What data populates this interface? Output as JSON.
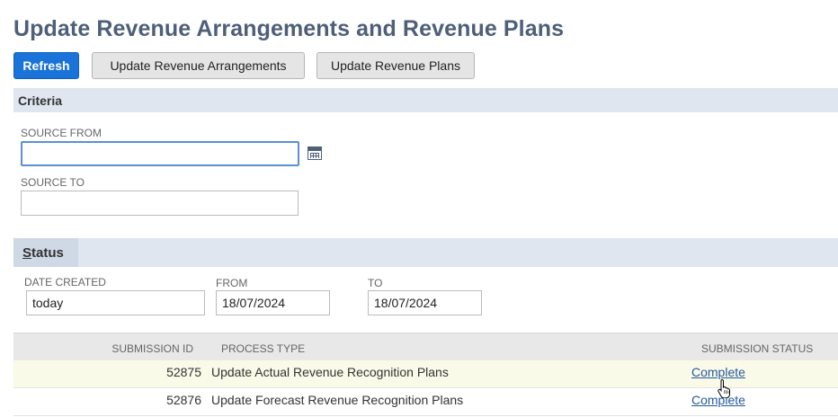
{
  "page": {
    "title": "Update Revenue Arrangements and Revenue Plans"
  },
  "toolbar": {
    "refresh_label": "Refresh",
    "update_arrangements_label": "Update Revenue Arrangements",
    "update_plans_label": "Update Revenue Plans"
  },
  "criteria": {
    "heading": "Criteria",
    "source_from_label": "SOURCE FROM",
    "source_from_value": "",
    "source_to_label": "SOURCE TO",
    "source_to_value": ""
  },
  "status": {
    "tab_label": "Status",
    "date_created_label": "DATE CREATED",
    "date_created_value": "today",
    "from_label": "FROM",
    "from_value": "18/07/2024",
    "to_label": "TO",
    "to_value": "18/07/2024"
  },
  "table": {
    "columns": [
      "SUBMISSION ID",
      "PROCESS TYPE",
      "SUBMISSION STATUS"
    ],
    "rows": [
      {
        "id": "52875",
        "type": "Update Actual Revenue Recognition Plans",
        "status": "Complete"
      },
      {
        "id": "52876",
        "type": "Update Forecast Revenue Recognition Plans",
        "status": "Complete"
      }
    ]
  },
  "icons": {
    "calendar": "calendar-icon",
    "cursor": "hand-pointer-cursor"
  },
  "colors": {
    "primary_button": "#1a73d9",
    "title": "#4d5f79",
    "section_bar": "#e0e6ef",
    "link": "#255a9c",
    "highlight_row": "#fafae8"
  }
}
